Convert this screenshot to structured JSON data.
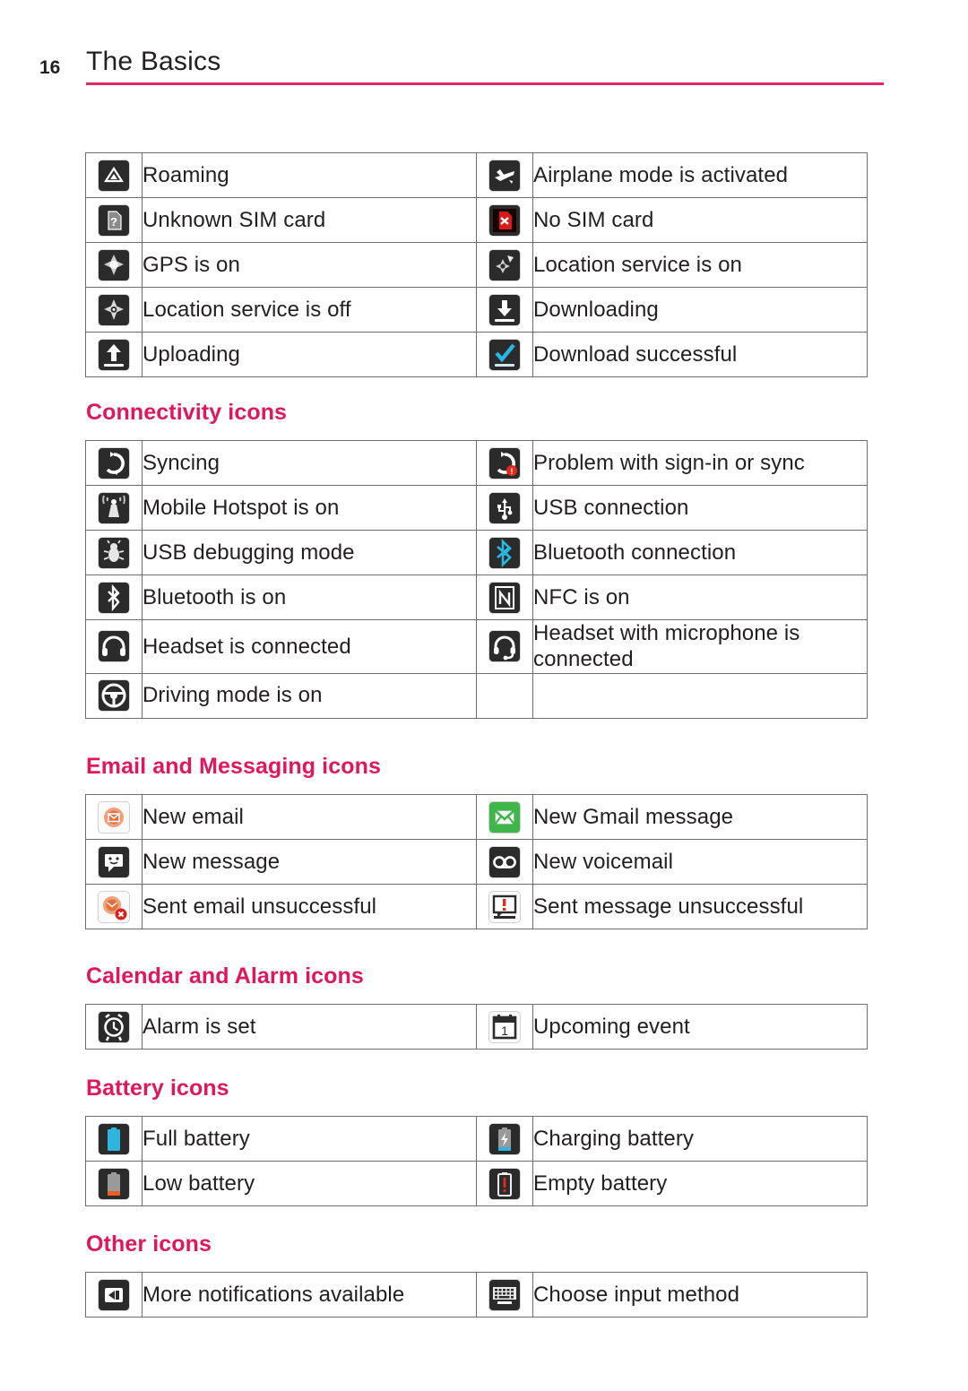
{
  "page": {
    "number": "16",
    "title": "The Basics",
    "rule_color": "#e5266d"
  },
  "theme": {
    "heading_color": "#e0175c",
    "text_color": "#231f20",
    "border_color": "#6d6e71"
  },
  "sections": [
    {
      "id": "status-icons",
      "heading": "",
      "rows": [
        {
          "left": {
            "icon": "roaming-icon",
            "label": "Roaming"
          },
          "right": {
            "icon": "airplane-mode-icon",
            "label": "Airplane mode is activated"
          }
        },
        {
          "left": {
            "icon": "unknown-sim-card-icon",
            "label": "Unknown SIM card"
          },
          "right": {
            "icon": "no-sim-card-icon",
            "label": "No SIM card"
          }
        },
        {
          "left": {
            "icon": "gps-on-icon",
            "label": "GPS is on"
          },
          "right": {
            "icon": "location-service-on-icon",
            "label": "Location service is on"
          }
        },
        {
          "left": {
            "icon": "location-service-off-icon",
            "label": "Location service is off"
          },
          "right": {
            "icon": "downloading-icon",
            "label": "Downloading"
          }
        },
        {
          "left": {
            "icon": "uploading-icon",
            "label": "Uploading"
          },
          "right": {
            "icon": "download-successful-icon",
            "label": "Download successful"
          }
        }
      ]
    },
    {
      "id": "connectivity-icons",
      "heading": "Connectivity icons",
      "rows": [
        {
          "left": {
            "icon": "syncing-icon",
            "label": "Syncing"
          },
          "right": {
            "icon": "sync-problem-icon",
            "label": "Problem with sign-in or sync"
          }
        },
        {
          "left": {
            "icon": "mobile-hotspot-icon",
            "label": "Mobile Hotspot is on"
          },
          "right": {
            "icon": "usb-connection-icon",
            "label": "USB connection"
          }
        },
        {
          "left": {
            "icon": "usb-debugging-icon",
            "label": "USB debugging mode"
          },
          "right": {
            "icon": "bluetooth-connection-icon",
            "label": "Bluetooth connection"
          }
        },
        {
          "left": {
            "icon": "bluetooth-on-icon",
            "label": "Bluetooth is on"
          },
          "right": {
            "icon": "nfc-on-icon",
            "label": "NFC is on"
          }
        },
        {
          "left": {
            "icon": "headset-icon",
            "label": "Headset is connected"
          },
          "right": {
            "icon": "headset-with-mic-icon",
            "label": "Headset with microphone is connected"
          }
        },
        {
          "left": {
            "icon": "driving-mode-icon",
            "label": "Driving mode is on"
          },
          "right": {
            "icon": "",
            "label": ""
          }
        }
      ]
    },
    {
      "id": "email-messaging-icons",
      "heading": "Email and Messaging icons",
      "rows": [
        {
          "left": {
            "icon": "new-email-icon",
            "label": "New email"
          },
          "right": {
            "icon": "new-gmail-icon",
            "label": "New Gmail message"
          }
        },
        {
          "left": {
            "icon": "new-message-icon",
            "label": "New message"
          },
          "right": {
            "icon": "new-voicemail-icon",
            "label": "New voicemail"
          }
        },
        {
          "left": {
            "icon": "sent-email-failed-icon",
            "label": "Sent email unsuccessful"
          },
          "right": {
            "icon": "sent-message-failed-icon",
            "label": "Sent message unsuccessful"
          }
        }
      ]
    },
    {
      "id": "calendar-alarm-icons",
      "heading": "Calendar and Alarm icons",
      "rows": [
        {
          "left": {
            "icon": "alarm-set-icon",
            "label": "Alarm is set"
          },
          "right": {
            "icon": "upcoming-event-icon",
            "label": "Upcoming event"
          }
        }
      ]
    },
    {
      "id": "battery-icons",
      "heading": "Battery icons",
      "rows": [
        {
          "left": {
            "icon": "full-battery-icon",
            "label": "Full battery"
          },
          "right": {
            "icon": "charging-battery-icon",
            "label": "Charging battery"
          }
        },
        {
          "left": {
            "icon": "low-battery-icon",
            "label": "Low battery"
          },
          "right": {
            "icon": "empty-battery-icon",
            "label": "Empty battery"
          }
        }
      ]
    },
    {
      "id": "other-icons",
      "heading": "Other icons",
      "rows": [
        {
          "left": {
            "icon": "more-notifications-icon",
            "label": "More notifications available"
          },
          "right": {
            "icon": "choose-input-method-icon",
            "label": "Choose input method"
          }
        }
      ]
    }
  ]
}
